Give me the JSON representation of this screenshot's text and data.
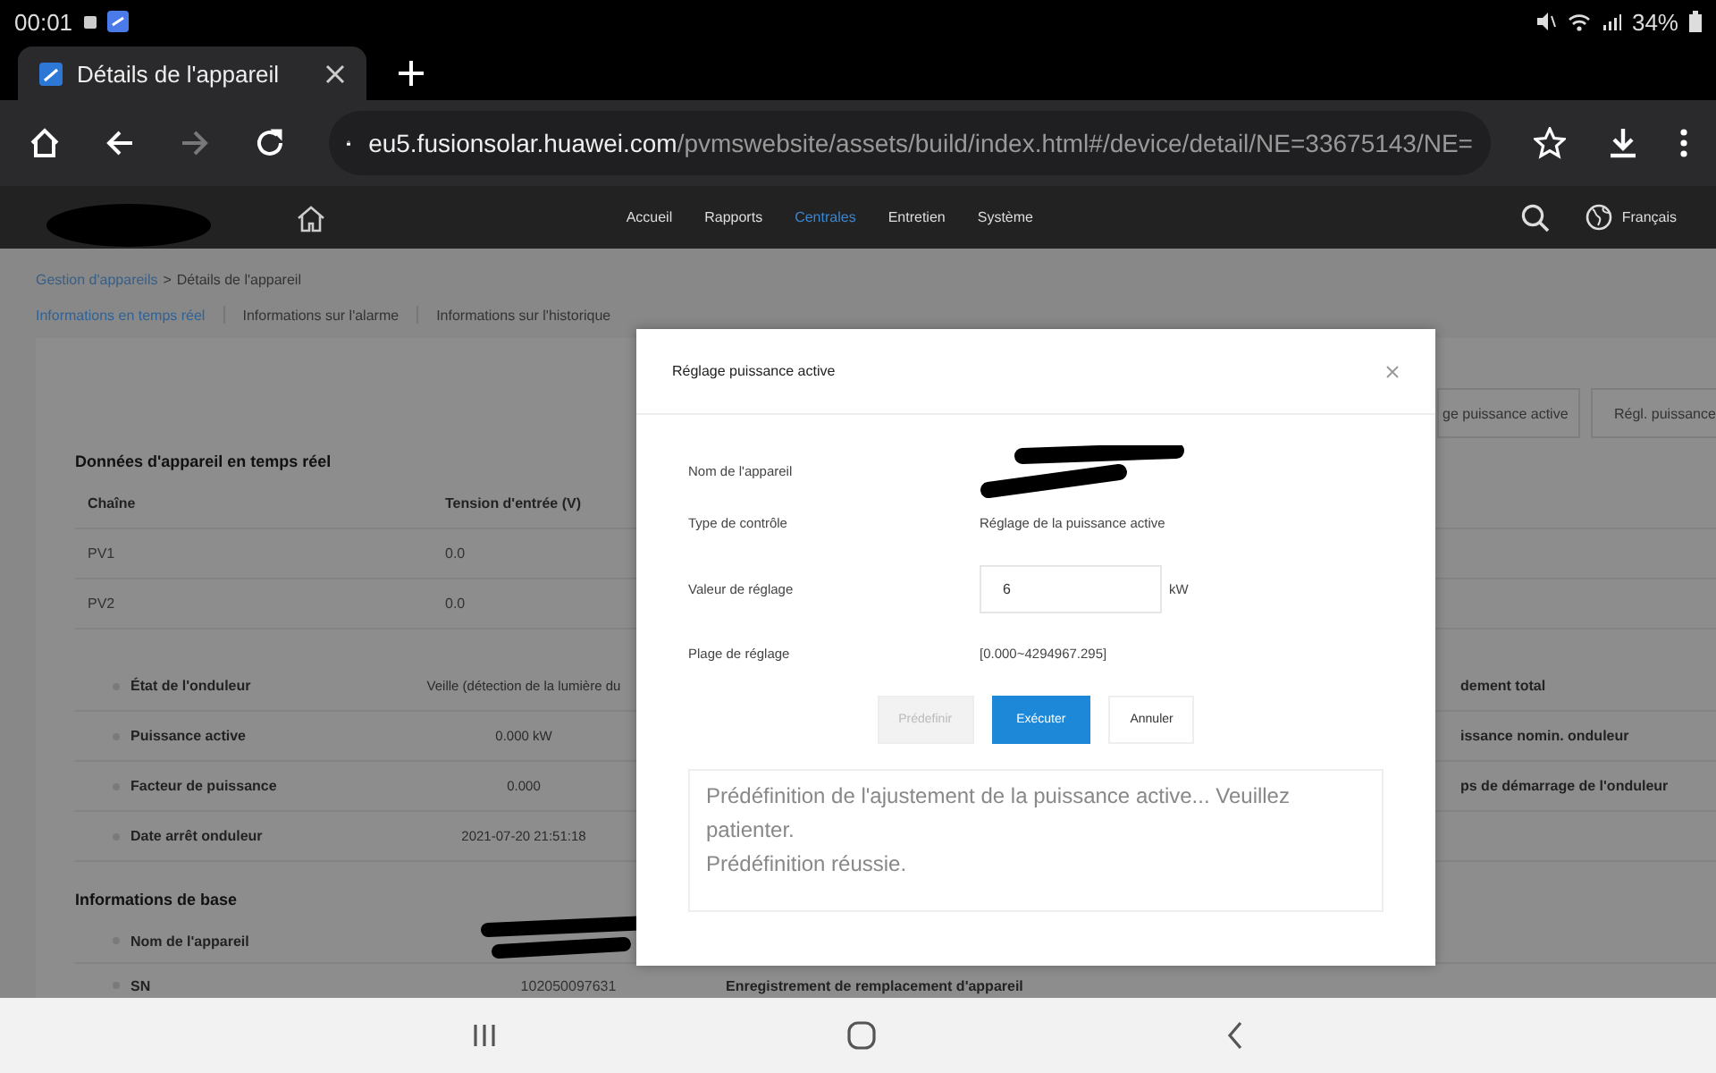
{
  "status_bar": {
    "time": "00:01",
    "battery": "34%"
  },
  "browser": {
    "tab_title": "Détails de l'appareil",
    "url_host": "eu5.fusionsolar.huawei.com",
    "url_path": "/pvmswebsite/assets/build/index.html#/device/detail/NE=33675143/NE="
  },
  "nav": {
    "items": [
      {
        "label": "Accueil",
        "selected": false
      },
      {
        "label": "Rapports",
        "selected": false
      },
      {
        "label": "Centrales",
        "selected": true
      },
      {
        "label": "Entretien",
        "selected": false
      },
      {
        "label": "Système",
        "selected": false
      }
    ],
    "language": "Français"
  },
  "breadcrumb": {
    "link": "Gestion d'appareils",
    "separator": ">",
    "current": "Détails de l'appareil"
  },
  "page_tabs": [
    {
      "label": "Informations en temps réel",
      "selected": true
    },
    {
      "label": "Informations sur l'alarme",
      "selected": false
    },
    {
      "label": "Informations sur l'historique",
      "selected": false
    }
  ],
  "action_buttons": [
    "ge puissance active",
    "Régl. puissance"
  ],
  "realtime": {
    "title": "Données d'appareil en temps réel",
    "columns": [
      "Chaîne",
      "Tension d'entrée (V)"
    ],
    "rows": [
      [
        "PV1",
        "0.0"
      ],
      [
        "PV2",
        "0.0"
      ]
    ],
    "fields": [
      {
        "label": "État de l'onduleur",
        "value": "Veille (détection de la lumière du",
        "right_label": "dement total"
      },
      {
        "label": "Puissance active",
        "value": "0.000 kW",
        "right_label": "issance nomin. onduleur"
      },
      {
        "label": "Facteur de puissance",
        "value": "0.000",
        "right_label": "ps de démarrage de l'onduleur"
      },
      {
        "label": "Date arrêt onduleur",
        "value": "2021-07-20 21:51:18"
      }
    ]
  },
  "basic": {
    "title": "Informations de base",
    "fields": [
      {
        "label": "Nom de l'appareil",
        "kind": "redacted"
      },
      {
        "label": "SN",
        "kind": "text",
        "value": "102050097631",
        "right_label": "Enregistrement de remplacement d'appareil"
      }
    ]
  },
  "dialog": {
    "title": "Réglage puissance active",
    "fields": [
      {
        "kind": "redacted",
        "label": "Nom de l'appareil"
      },
      {
        "kind": "text",
        "label": "Type de contrôle",
        "value": "Réglage de la puissance active"
      },
      {
        "kind": "input",
        "label": "Valeur de réglage",
        "value": "6",
        "unit": "kW"
      },
      {
        "kind": "text",
        "label": "Plage de réglage",
        "value": "[0.000~4294967.295]"
      }
    ],
    "buttons": [
      {
        "label": "Prédefinir",
        "kind": "default",
        "disabled": true
      },
      {
        "label": "Exécuter",
        "kind": "primary",
        "disabled": false
      },
      {
        "label": "Annuler",
        "kind": "default",
        "disabled": false
      }
    ],
    "log": [
      "Prédéfinition de l'ajustement de la puissance active... Veuillez patienter.",
      "Prédéfinition réussie."
    ]
  }
}
